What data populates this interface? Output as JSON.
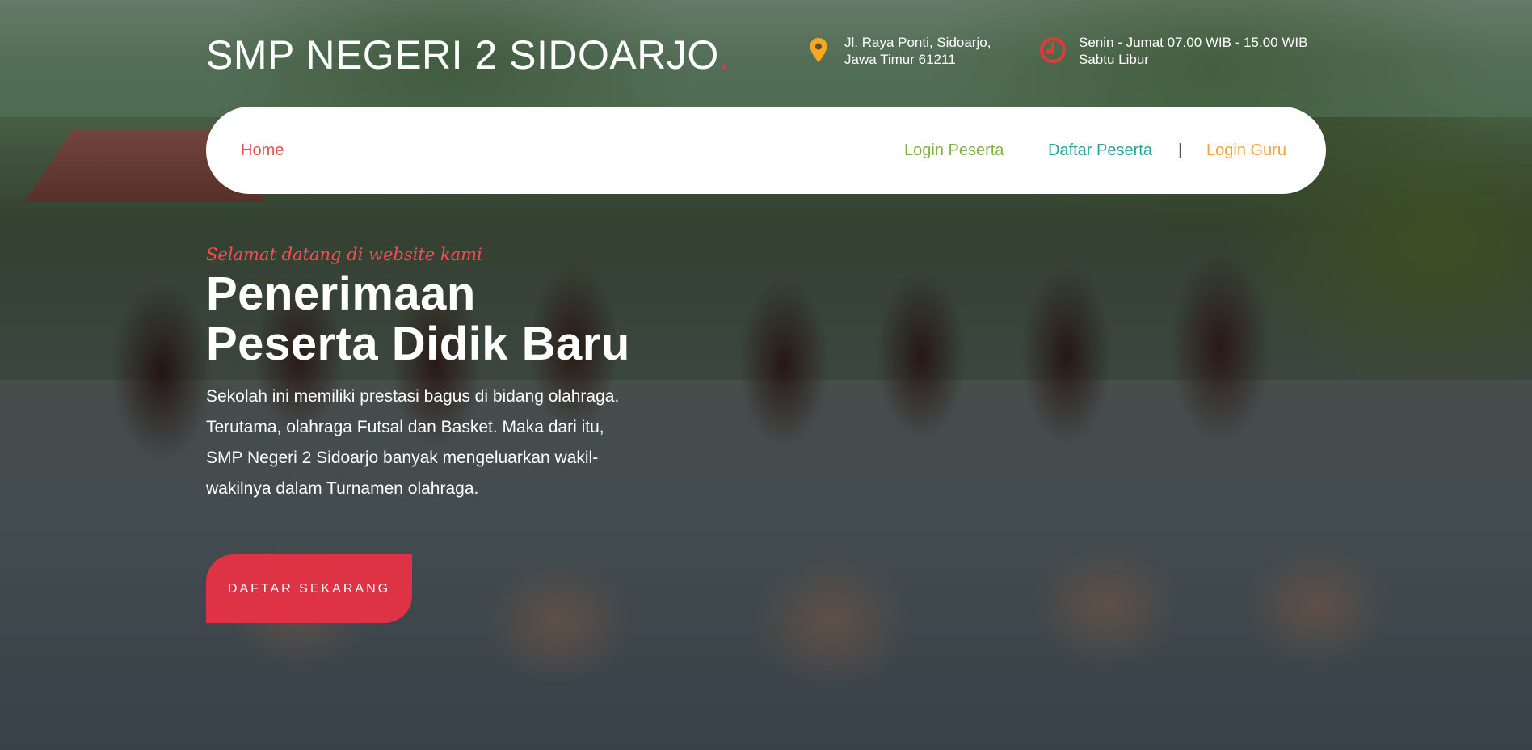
{
  "header": {
    "brand": "SMP NEGERI 2 SIDOARJO",
    "brand_dot": ".",
    "address": {
      "icon": "map-pin-icon",
      "line1": "Jl. Raya Ponti, Sidoarjo,",
      "line2": "Jawa Timur 61211"
    },
    "hours": {
      "icon": "clock-icon",
      "line1": "Senin - Jumat 07.00 WIB - 15.00 WIB",
      "line2": "Sabtu Libur"
    }
  },
  "nav": {
    "home": "Home",
    "login_peserta": "Login Peserta",
    "daftar_peserta": "Daftar Peserta",
    "separator": "|",
    "login_guru": "Login Guru"
  },
  "hero": {
    "tagline": "Selamat datang di website kami",
    "title_line1": "Penerimaan",
    "title_line2": "Peserta Didik Baru",
    "desc_lines": [
      "Sekolah ini memiliki prestasi bagus di bidang olahraga.",
      "Terutama, olahraga Futsal dan Basket. Maka dari itu,",
      "SMP Negeri 2 Sidoarjo banyak mengeluarkan wakil-",
      "wakilnya dalam Turnamen olahraga."
    ],
    "cta": "DAFTAR SEKARANG"
  },
  "colors": {
    "accent_red": "#dd3344",
    "nav_home": "#e8534f",
    "nav_login_peserta": "#7cb342",
    "nav_daftar_peserta": "#26a69a",
    "nav_login_guru": "#f0a43a",
    "icon_pin": "#f5a623",
    "icon_clock": "#e53935"
  }
}
